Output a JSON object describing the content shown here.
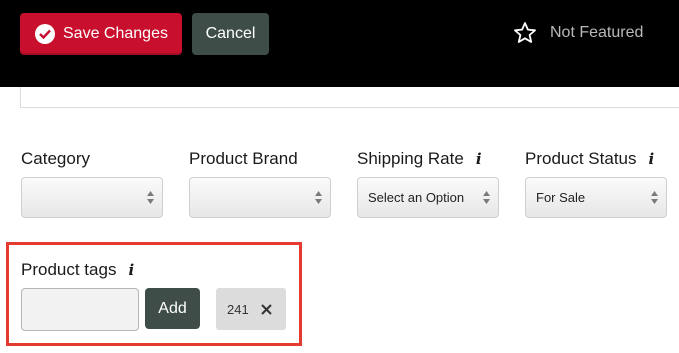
{
  "toolbar": {
    "save_label": "Save Changes",
    "cancel_label": "Cancel",
    "featured_label": "Not Featured"
  },
  "fields": {
    "category": {
      "label": "Category",
      "value": ""
    },
    "brand": {
      "label": "Product Brand",
      "value": ""
    },
    "shipping": {
      "label": "Shipping Rate",
      "value": "Select an Option",
      "info_icon": "info-icon"
    },
    "status": {
      "label": "Product Status",
      "value": "For Sale",
      "info_icon": "info-icon"
    }
  },
  "tags": {
    "label": "Product tags",
    "input_value": "",
    "add_label": "Add",
    "items": [
      "241"
    ]
  },
  "colors": {
    "save_button": "#c8102e",
    "dark_button": "#3e4d48",
    "highlight_border": "#e53a2f",
    "topbar": "#000000"
  }
}
